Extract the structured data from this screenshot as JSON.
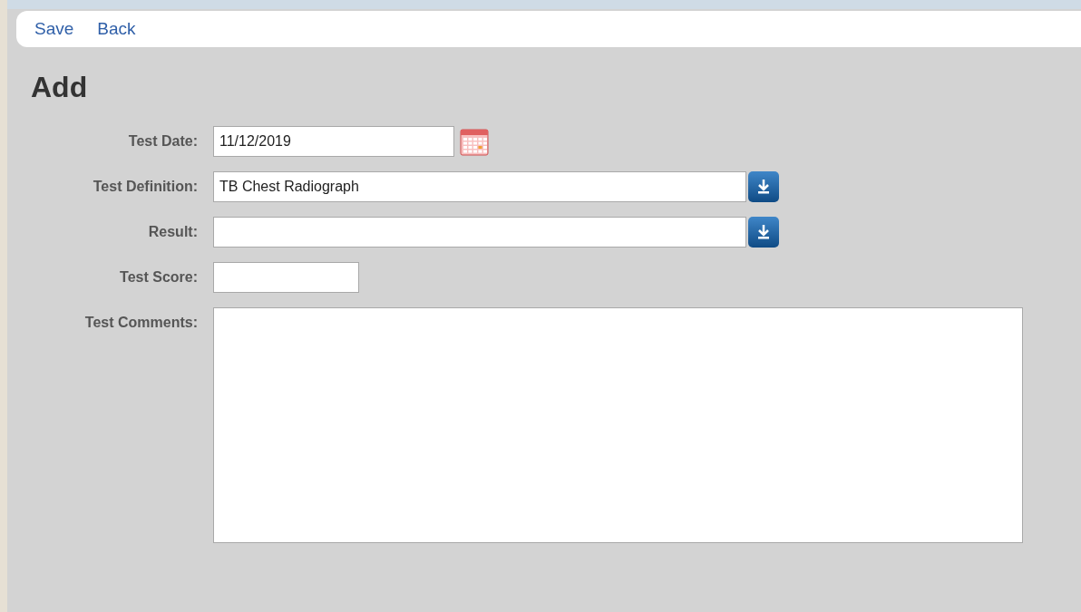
{
  "toolbar": {
    "links": [
      "Save",
      "Back"
    ]
  },
  "title": "Add",
  "fields": [
    {
      "kind": "date",
      "label": "Test Date:",
      "value": "11/12/2019"
    },
    {
      "kind": "select",
      "label": "Test Definition:",
      "value": "TB Chest Radiograph"
    },
    {
      "kind": "select",
      "label": "Result:"
    },
    {
      "kind": "text",
      "label": "Test Score:"
    },
    {
      "kind": "textarea",
      "label": "Test Comments:"
    }
  ]
}
